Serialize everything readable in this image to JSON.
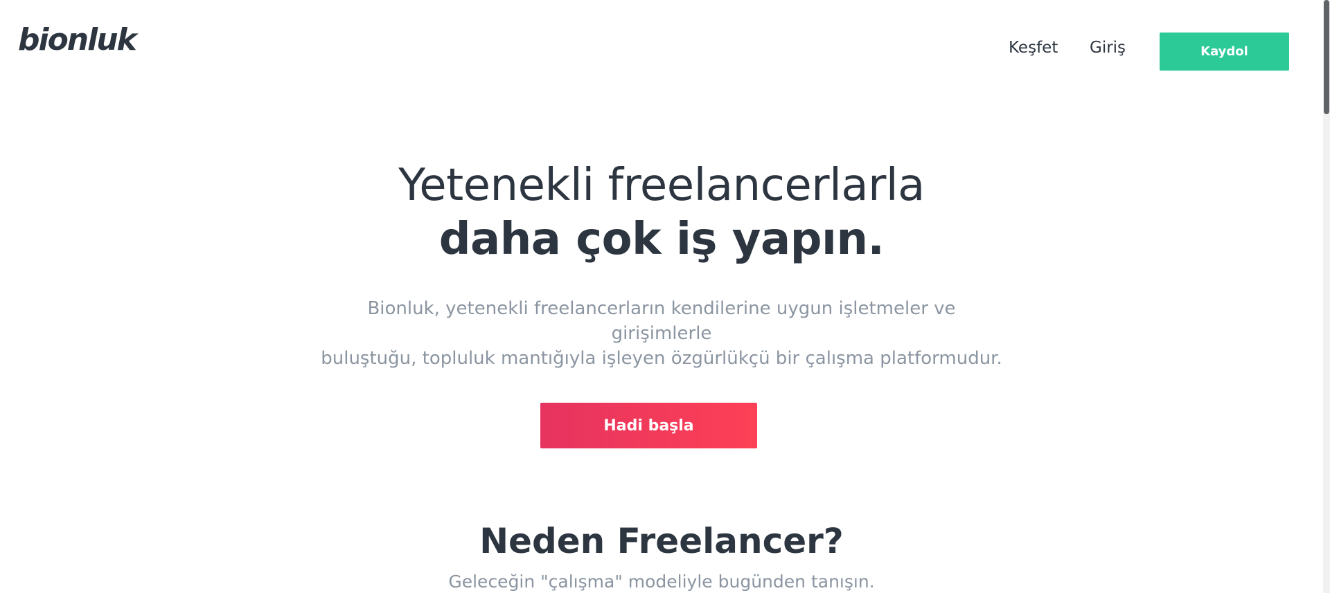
{
  "header": {
    "logo_text": "bionluk",
    "nav": {
      "explore_label": "Keşfet",
      "login_label": "Giriş",
      "signup_label": "Kaydol"
    }
  },
  "hero": {
    "title_line1": "Yetenekli freelancerlarla",
    "title_line2": "daha çok iş yapın.",
    "description_line1": "Bionluk, yetenekli freelancerların kendilerine uygun işletmeler ve girişimlerle",
    "description_line2": "buluştuğu, topluluk mantığıyla işleyen özgürlükçü bir çalışma platformudur.",
    "cta_label": "Hadi başla"
  },
  "why_section": {
    "title_regular": "Neden",
    "title_bold": "Freelancer?",
    "subtitle": "Geleceğin \"çalışma\" modeliyle bugünden tanışın."
  },
  "colors": {
    "text_dark": "#2d3640",
    "text_muted": "#8b95a1",
    "signup_green": "#2bca97",
    "cta_gradient_start": "#e6335f",
    "cta_gradient_end": "#fd4056"
  }
}
